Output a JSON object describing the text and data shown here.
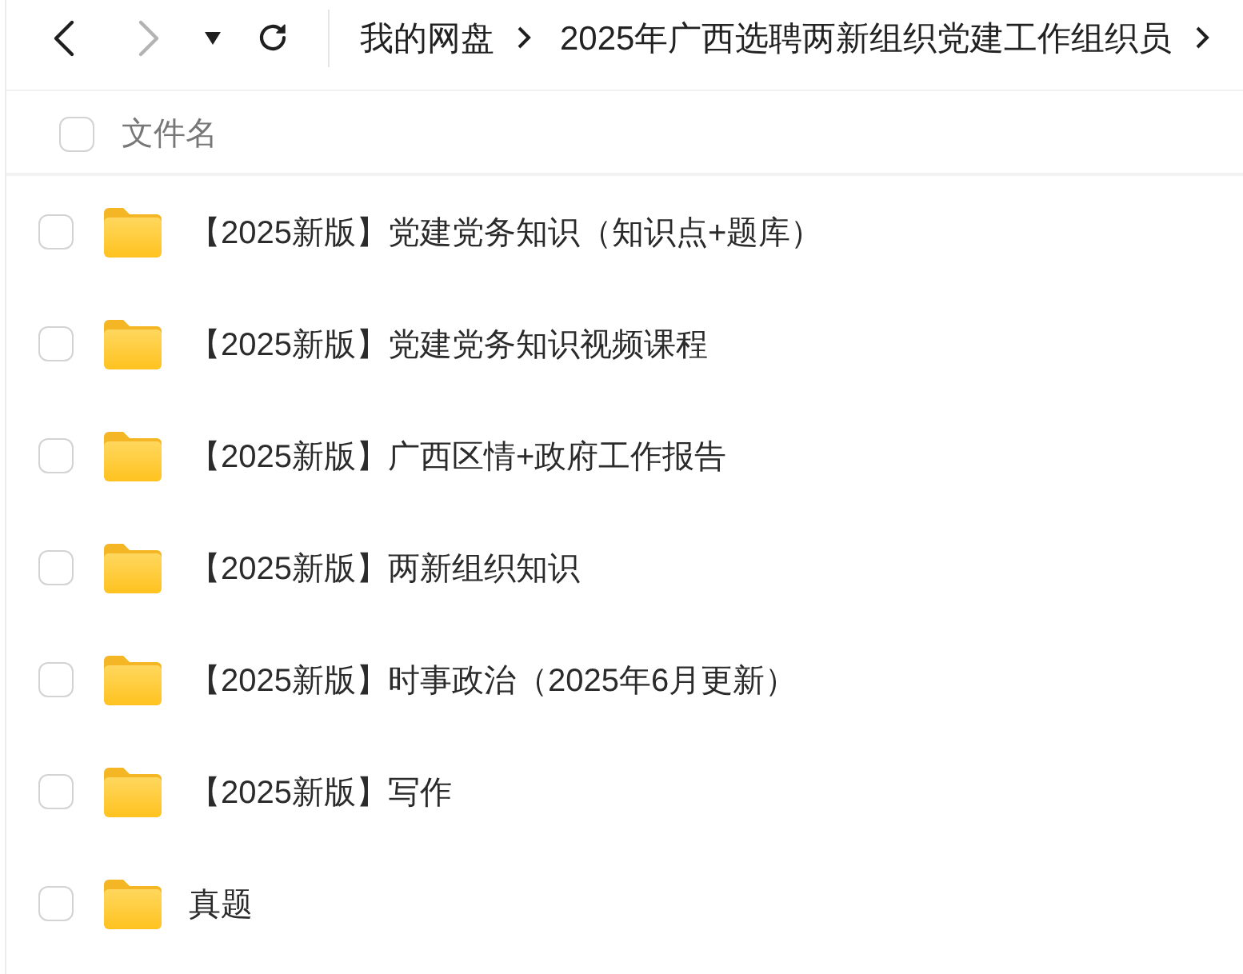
{
  "nav": {
    "back": {
      "disabled": false
    },
    "forward": {
      "disabled": true
    }
  },
  "breadcrumb": [
    {
      "label": "我的网盘"
    },
    {
      "label": "2025年广西选聘两新组织党建工作组织员"
    }
  ],
  "header": {
    "label": "文件名",
    "checked": false
  },
  "files": [
    {
      "name": "【2025新版】党建党务知识（知识点+题库）",
      "checked": false
    },
    {
      "name": "【2025新版】党建党务知识视频课程",
      "checked": false
    },
    {
      "name": "【2025新版】广西区情+政府工作报告",
      "checked": false
    },
    {
      "name": "【2025新版】两新组织知识",
      "checked": false
    },
    {
      "name": "【2025新版】时事政治（2025年6月更新）",
      "checked": false
    },
    {
      "name": "【2025新版】写作",
      "checked": false
    },
    {
      "name": "真题",
      "checked": false
    }
  ]
}
